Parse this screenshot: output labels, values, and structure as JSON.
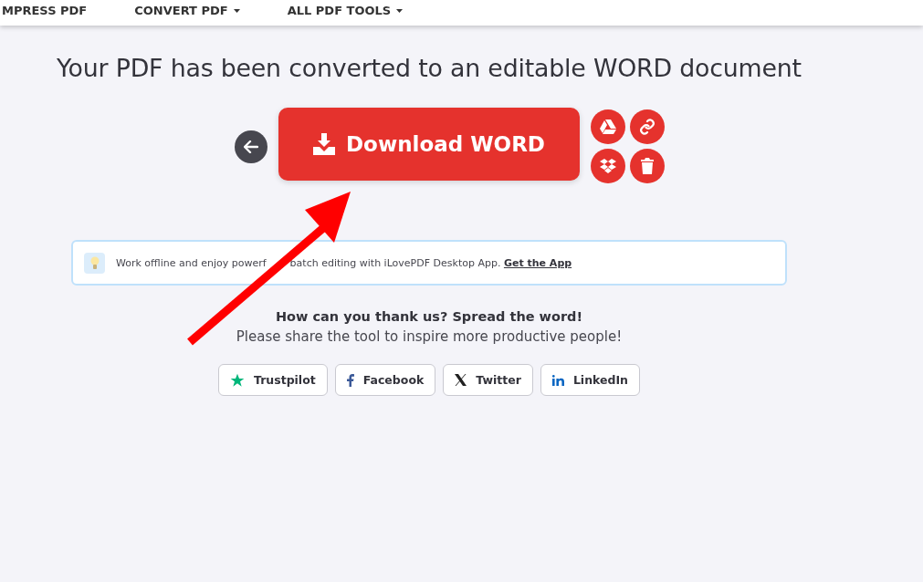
{
  "nav": [
    {
      "label": "MPRESS PDF",
      "dropdown": false
    },
    {
      "label": "CONVERT PDF",
      "dropdown": true
    },
    {
      "label": "ALL PDF TOOLS",
      "dropdown": true
    }
  ],
  "title": "Your PDF has been converted to an editable WORD document",
  "download": {
    "label": "Download WORD"
  },
  "actions": [
    {
      "kind": "drive"
    },
    {
      "kind": "link"
    },
    {
      "kind": "dropbox"
    },
    {
      "kind": "delete"
    }
  ],
  "notice": {
    "text": "Work offline and enjoy powerf",
    "text_after": "batch editing with iLovePDF Desktop App.",
    "link": "Get the App"
  },
  "share": {
    "heading": "How can you thank us? Spread the word!",
    "subtitle": "Please share the tool to inspire more productive people!",
    "buttons": [
      {
        "kind": "trustpilot",
        "label": "Trustpilot"
      },
      {
        "kind": "facebook",
        "label": "Facebook"
      },
      {
        "kind": "twitter",
        "label": "Twitter"
      },
      {
        "kind": "linkedin",
        "label": "LinkedIn"
      }
    ]
  }
}
